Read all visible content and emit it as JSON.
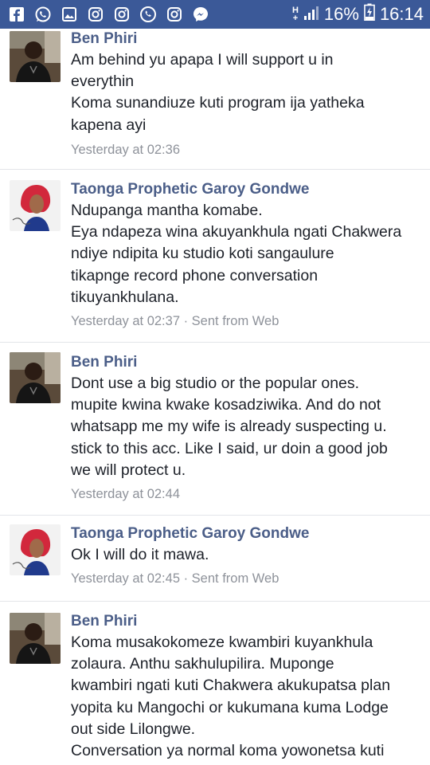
{
  "status_bar": {
    "network": "H",
    "network_sub": "+",
    "battery": "16%",
    "time": "16:14",
    "icons": [
      "facebook-icon",
      "whatsapp-icon",
      "gallery-icon",
      "instagram-icon",
      "instagram-icon",
      "phone-refresh-icon",
      "instagram-icon",
      "messenger-icon"
    ]
  },
  "colors": {
    "status_bar_bg": "#3b5998",
    "name": "#4b5e88",
    "text": "#1d2129",
    "meta": "#8e929a"
  },
  "messages": [
    {
      "sender": "Ben Phiri",
      "lines": [
        "Am behind yu apapa I will support u in",
        "everythin",
        "Koma sunandiuze kuti program ija yatheka",
        "kapena ayi"
      ],
      "time": "Yesterday at 02:36",
      "source": ""
    },
    {
      "sender": "Taonga Prophetic Garoy Gondwe",
      "lines": [
        "Ndupanga mantha komabe.",
        "Eya ndapeza wina akuyankhula ngati Chakwera",
        "ndiye ndipita ku studio koti sangaulure",
        "tikapnge record phone conversation",
        "tikuyankhulana."
      ],
      "time": "Yesterday at 02:37",
      "source": " · Sent from Web"
    },
    {
      "sender": "Ben Phiri",
      "lines": [
        "Dont use a big studio or the popular ones.",
        "mupite kwina kwake kosadziwika. And do not",
        "whatsapp me my wife is already suspecting u.",
        "stick to this acc. Like I said, ur doin a good job",
        "we will protect u."
      ],
      "time": "Yesterday at 02:44",
      "source": ""
    },
    {
      "sender": "Taonga Prophetic Garoy Gondwe",
      "lines": [
        "Ok I will do it mawa."
      ],
      "time": "Yesterday at 02:45",
      "source": " · Sent from Web"
    },
    {
      "sender": "Ben Phiri",
      "lines": [
        "Koma musakokomeze kwambiri kuyankhula",
        "zolaura. Anthu sakhulupilira. Muponge",
        "kwambiri ngati kuti Chakwera akukupatsa plan",
        "yopita ku Mangochi or kukumana kuma Lodge",
        "out side Lilongwe.",
        "Conversation ya normal koma yowonetsa kuti"
      ],
      "time": "",
      "source": ""
    }
  ]
}
